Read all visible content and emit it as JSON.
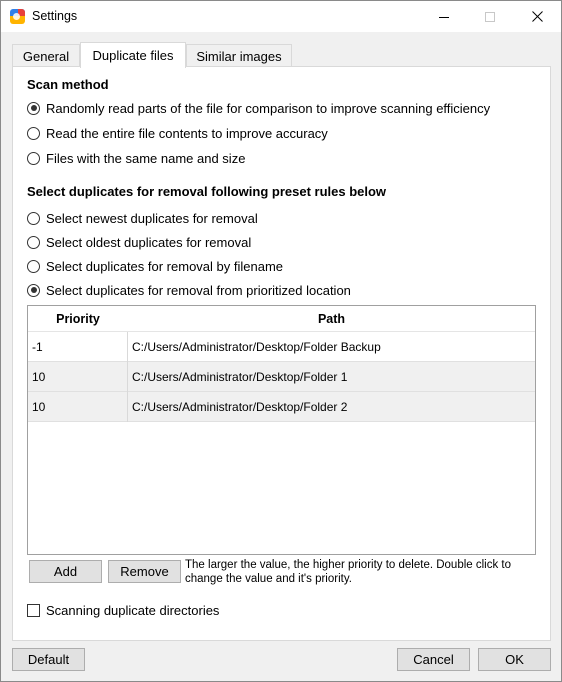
{
  "window": {
    "title": "Settings"
  },
  "tabs": [
    {
      "label": "General",
      "active": false
    },
    {
      "label": "Duplicate files",
      "active": true
    },
    {
      "label": "Similar images",
      "active": false
    }
  ],
  "scan_method": {
    "title": "Scan method",
    "options": [
      {
        "label": "Randomly read parts of the file for comparison to improve scanning efficiency",
        "checked": true
      },
      {
        "label": "Read the entire file contents to improve accuracy",
        "checked": false
      },
      {
        "label": "Files with the same name and size",
        "checked": false
      }
    ]
  },
  "removal_rules": {
    "title": "Select duplicates for removal following preset rules below",
    "options": [
      {
        "label": "Select newest duplicates for removal",
        "checked": false
      },
      {
        "label": "Select oldest duplicates for removal",
        "checked": false
      },
      {
        "label": "Select duplicates for removal by filename",
        "checked": false
      },
      {
        "label": "Select duplicates for removal from prioritized location",
        "checked": true
      }
    ]
  },
  "table": {
    "columns": [
      "Priority",
      "Path"
    ],
    "rows": [
      {
        "priority": "-1",
        "path": "C:/Users/Administrator/Desktop/Folder Backup"
      },
      {
        "priority": "10",
        "path": "C:/Users/Administrator/Desktop/Folder 1"
      },
      {
        "priority": "10",
        "path": "C:/Users/Administrator/Desktop/Folder 2"
      }
    ]
  },
  "table_actions": {
    "add_label": "Add",
    "remove_label": "Remove",
    "hint": "The larger the value, the higher priority to delete. Double click to change the value and it's priority."
  },
  "scan_dirs": {
    "label": "Scanning duplicate directories",
    "checked": false
  },
  "footer": {
    "default_label": "Default",
    "cancel_label": "Cancel",
    "ok_label": "OK"
  },
  "icons": {
    "app": "app-logo-icon",
    "minimize": "minimize-icon",
    "maximize": "maximize-icon",
    "close": "close-icon"
  }
}
